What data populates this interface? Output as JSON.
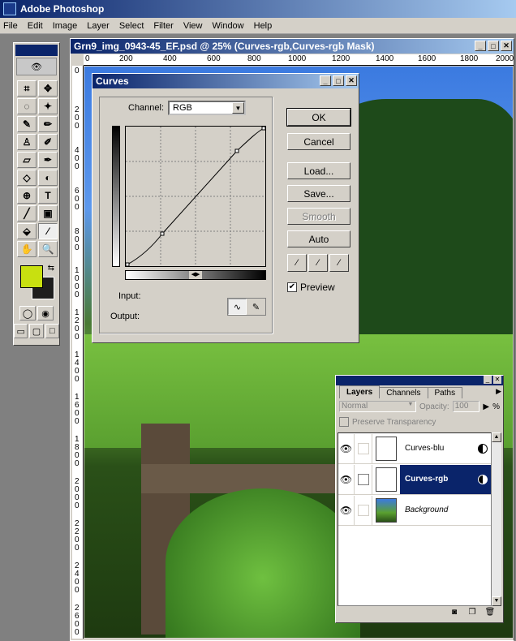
{
  "app": {
    "title": "Adobe Photoshop"
  },
  "menu": [
    "File",
    "Edit",
    "Image",
    "Layer",
    "Select",
    "Filter",
    "View",
    "Window",
    "Help"
  ],
  "document": {
    "title": "Grn9_img_0943-45_EF.psd @ 25% (Curves-rgb,Curves-rgb Mask)",
    "ruler_h": [
      "0",
      "200",
      "400",
      "600",
      "800",
      "1000",
      "1200",
      "1400",
      "1600",
      "1800",
      "2000"
    ],
    "ruler_v": [
      "0",
      "200",
      "400",
      "600",
      "800",
      "1000",
      "1200",
      "1400",
      "1600",
      "1800",
      "2000",
      "2200",
      "2400",
      "2600"
    ]
  },
  "curves": {
    "title": "Curves",
    "channel_label": "Channel:",
    "channel_value": "RGB",
    "input_label": "Input:",
    "output_label": "Output:",
    "buttons": {
      "ok": "OK",
      "cancel": "Cancel",
      "load": "Load...",
      "save": "Save...",
      "smooth": "Smooth",
      "auto": "Auto"
    },
    "preview_label": "Preview",
    "preview_checked": "✔"
  },
  "layers": {
    "tabs": [
      "Layers",
      "Channels",
      "Paths"
    ],
    "blend_mode": "Normal",
    "opacity_label": "Opacity:",
    "opacity_value": "100",
    "opacity_unit": "%",
    "preserve_label": "Preserve Transparency",
    "items": [
      {
        "name": "Curves-blu"
      },
      {
        "name": "Curves-rgb"
      },
      {
        "name": "Background"
      }
    ]
  },
  "colors": {
    "foreground": "#c8e010",
    "background": "#1e1e1e",
    "titlebar": "#0a246a"
  }
}
